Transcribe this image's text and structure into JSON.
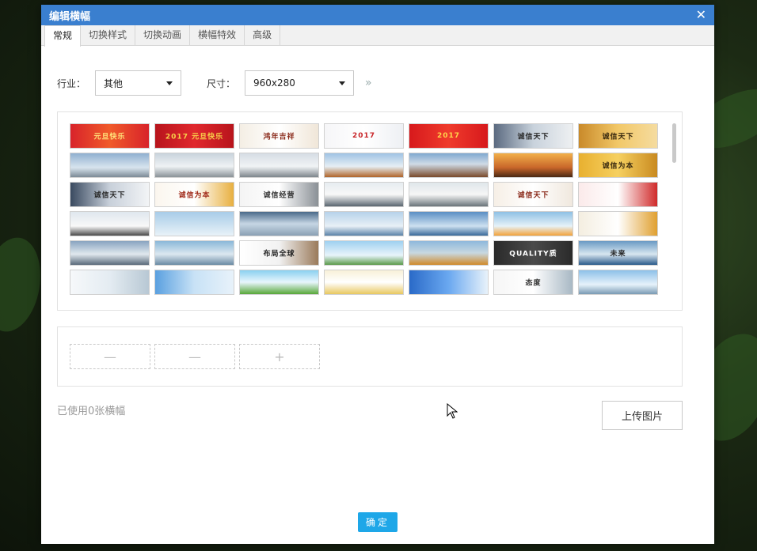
{
  "dialog": {
    "title": "编辑横幅",
    "close_glyph": "✕"
  },
  "tabs": [
    {
      "label": "常规",
      "active": true
    },
    {
      "label": "切换样式"
    },
    {
      "label": "切换动画"
    },
    {
      "label": "横幅特效"
    },
    {
      "label": "高级"
    }
  ],
  "filters": {
    "industry_label": "行业：",
    "industry_value": "其他",
    "size_label": "尺寸：",
    "size_value": "960x280",
    "more_glyph": "»"
  },
  "gallery": {
    "thumbnails": [
      {
        "text": "元旦快乐",
        "bg": "linear-gradient(90deg,#d8232a,#f05a2a,#d8232a)",
        "fg": "#ffe27a"
      },
      {
        "text": "2017 元旦快乐",
        "bg": "linear-gradient(90deg,#b8141c,#e0282d,#b8141c)",
        "fg": "#f8d04a"
      },
      {
        "text": "鸿年吉祥",
        "bg": "linear-gradient(90deg,#f4eee4,#fff,#f0e6d8)",
        "fg": "#8a2a1a"
      },
      {
        "text": "2017",
        "bg": "linear-gradient(90deg,#f6f6f8,#fff,#eef0f4)",
        "fg": "#c8262a"
      },
      {
        "text": "2017",
        "bg": "linear-gradient(90deg,#d7191c,#ef3b2c,#d7191c)",
        "fg": "#ffd34a"
      },
      {
        "text": "诚信天下",
        "bg": "linear-gradient(90deg,#5b6a80,#c8d2dc,#eef0f2)",
        "fg": "#2a2a2a"
      },
      {
        "text": "诚信天下",
        "bg": "linear-gradient(90deg,#c98a2a,#f2c868,#f5dca0)",
        "fg": "#3a2a10"
      },
      {
        "text": "",
        "bg": "linear-gradient(180deg,#8fb0d0,#d8e4ee 60%,#7c8a96)",
        "fg": "#333"
      },
      {
        "text": "",
        "bg": "linear-gradient(180deg,#c9d3dc,#eef2f4 55%,#8a9298)",
        "fg": "#333"
      },
      {
        "text": "",
        "bg": "linear-gradient(180deg,#d6dde4,#f0f3f5 55%,#7e868c)",
        "fg": "#333"
      },
      {
        "text": "",
        "bg": "linear-gradient(180deg,#9fc3e4,#e6eef4 55%,#b0652a)",
        "fg": "#333"
      },
      {
        "text": "",
        "bg": "linear-gradient(180deg,#7fa8d0,#cfdbe6 45%,#7a4a2a)",
        "fg": "#333"
      },
      {
        "text": "",
        "bg": "linear-gradient(180deg,#f2b04a,#c8662a 60%,#4a2a14)",
        "fg": "#fff"
      },
      {
        "text": "诚信为本",
        "bg": "linear-gradient(90deg,#e8b030,#f6d060,#c98a20)",
        "fg": "#3a2a10"
      },
      {
        "text": "诚信天下",
        "bg": "linear-gradient(90deg,#3a4a60,#c8d0da,#f2f4f6)",
        "fg": "#2a2a2a"
      },
      {
        "text": "诚信为本",
        "bg": "linear-gradient(90deg,#fbf6ee,#fff,#e8b040)",
        "fg": "#a02a1a"
      },
      {
        "text": "诚信经营",
        "bg": "linear-gradient(90deg,#f4f4f4,#fff,#8a9096)",
        "fg": "#333"
      },
      {
        "text": "",
        "bg": "linear-gradient(180deg,#e6ecf0,#f8f8f8 50%,#5a6670)",
        "fg": "#333"
      },
      {
        "text": "",
        "bg": "linear-gradient(180deg,#dfe6ea,#f6f6f6 50%,#6a747a)",
        "fg": "#333"
      },
      {
        "text": "诚信天下",
        "bg": "linear-gradient(90deg,#f6efe6,#fff,#f0e8de)",
        "fg": "#8a2a1a"
      },
      {
        "text": "",
        "bg": "linear-gradient(90deg,#fbeaea,#fff,#d02a2a)",
        "fg": "#a0141c"
      },
      {
        "text": "",
        "bg": "linear-gradient(180deg,#dfe7ee,#f8f8f8 60%,#4a4a4a)",
        "fg": "#333"
      },
      {
        "text": "",
        "bg": "linear-gradient(180deg,#a8cce8,#e8f2f8)",
        "fg": "#333"
      },
      {
        "text": "",
        "bg": "linear-gradient(180deg,#4a6a8a,#c6d6e4 50%,#8aa0b4)",
        "fg": "#333"
      },
      {
        "text": "",
        "bg": "linear-gradient(180deg,#b6d2ea,#e8f0f6 60%,#5a82a8)",
        "fg": "#333"
      },
      {
        "text": "",
        "bg": "linear-gradient(180deg,#5a8ec4,#cde0f0 60%,#3a6a9a)",
        "fg": "#333"
      },
      {
        "text": "",
        "bg": "linear-gradient(180deg,#8ec0e4,#e6f2f8 60%,#f2a23a)",
        "fg": "#333"
      },
      {
        "text": "",
        "bg": "linear-gradient(90deg,#f4eee0,#fff,#e0a030)",
        "fg": "#3a2a10"
      },
      {
        "text": "",
        "bg": "linear-gradient(180deg,#88a4c0,#e0e8ee 55%,#5a6a7a)",
        "fg": "#333"
      },
      {
        "text": "",
        "bg": "linear-gradient(180deg,#8ab8d8,#dce8f0 55%,#6a8aa4)",
        "fg": "#333"
      },
      {
        "text": "布局全球",
        "bg": "linear-gradient(90deg,#ffffff,#f2f2f2,#9a7a5a)",
        "fg": "#222"
      },
      {
        "text": "",
        "bg": "linear-gradient(180deg,#9fd0f0,#e8f4fa 60%,#5a9a4a)",
        "fg": "#333"
      },
      {
        "text": "",
        "bg": "linear-gradient(180deg,#8eb8dc,#c8d8e0 50%,#d08a2a)",
        "fg": "#333"
      },
      {
        "text": "QUALITY质",
        "bg": "linear-gradient(90deg,#2a2a2a,#4a4a4a,#2a2a2a)",
        "fg": "#fff"
      },
      {
        "text": "未来",
        "bg": "linear-gradient(180deg,#6a9ac4,#d8e6f0 55%,#2a5a8a)",
        "fg": "#222"
      },
      {
        "text": "",
        "bg": "linear-gradient(90deg,#f6f8fa,#e4ecf2,#b8c8d4)",
        "fg": "#333"
      },
      {
        "text": "",
        "bg": "linear-gradient(90deg,#5aa0e0,#c8e2f6,#e8f2fa)",
        "fg": "#333"
      },
      {
        "text": "",
        "bg": "linear-gradient(180deg,#8ad0f0,#e8f6fc 50%,#58a83a)",
        "fg": "#333"
      },
      {
        "text": "",
        "bg": "linear-gradient(180deg,#f8f0d8,#fff 50%,#e8c860)",
        "fg": "#333"
      },
      {
        "text": "",
        "bg": "linear-gradient(90deg,#2a6ac8,#6aa8f0,#e8f2fa)",
        "fg": "#fff"
      },
      {
        "text": "态度",
        "bg": "linear-gradient(90deg,#f6f6f6,#fff,#a8b8c4)",
        "fg": "#333"
      },
      {
        "text": "",
        "bg": "linear-gradient(180deg,#8cc0e8,#e6f2fa 60%,#7a9ab4)",
        "fg": "#333"
      }
    ]
  },
  "selected": {
    "slots": [
      {
        "glyph": "—"
      },
      {
        "glyph": "—"
      },
      {
        "glyph": "+"
      }
    ]
  },
  "footer": {
    "used_text": "已使用0张横幅",
    "upload_label": "上传图片",
    "ok_label": "确定"
  },
  "colors": {
    "titlebar": "#3a7fcf",
    "ok_button": "#1ea7e8"
  }
}
